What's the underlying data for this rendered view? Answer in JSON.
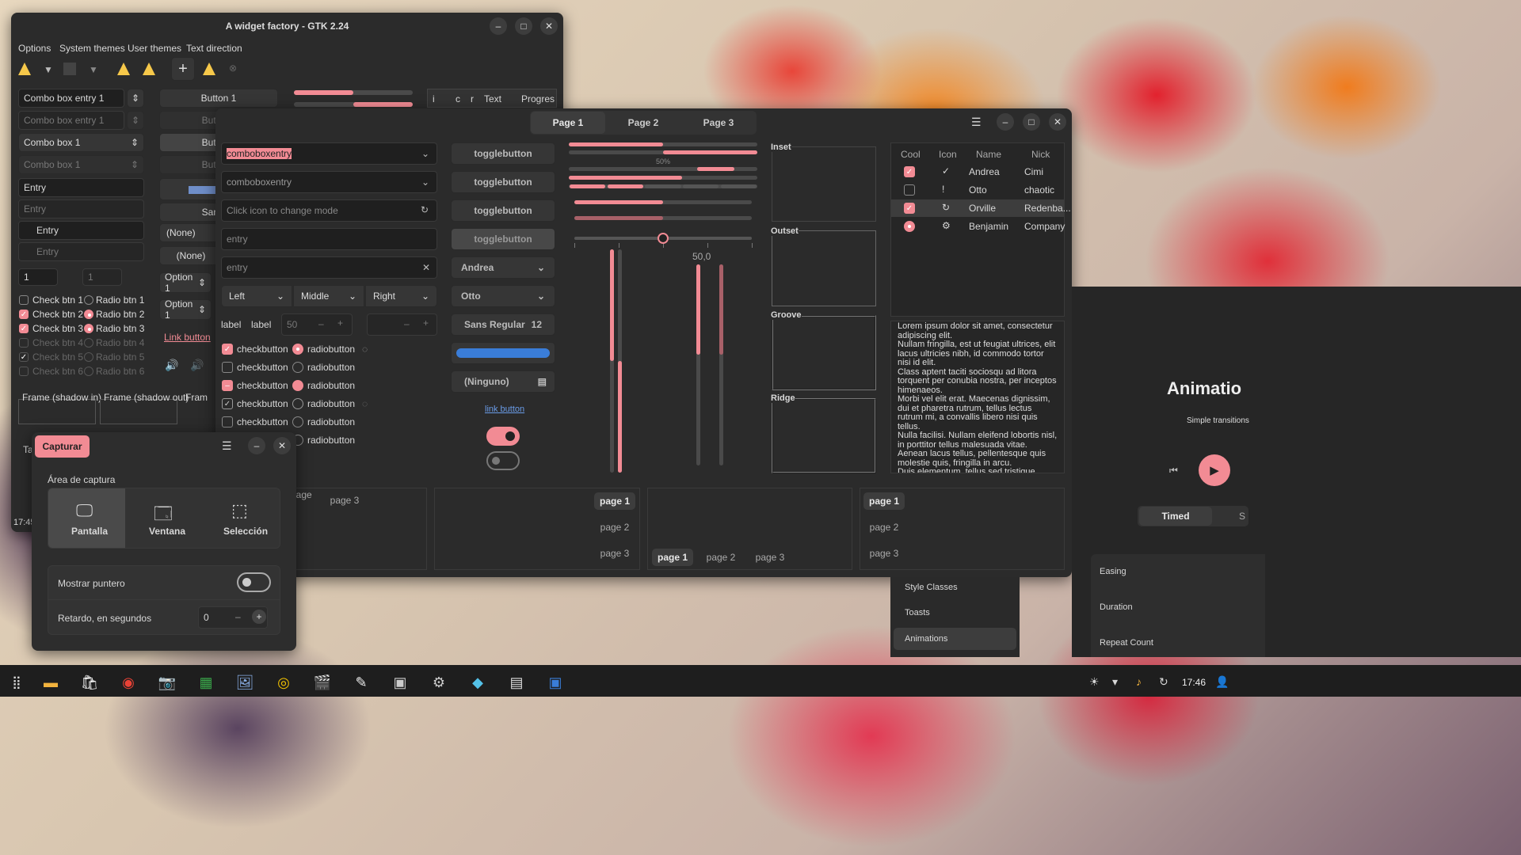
{
  "gtk2": {
    "title": "A widget factory - GTK 2.24",
    "menu": [
      "Options",
      "System themes",
      "User themes",
      "Text direction"
    ],
    "combo_entry_1": "Combo box entry 1",
    "combo_entry_1_dis": "Combo box entry 1",
    "combo_1": "Combo box 1",
    "combo_1_dis": "Combo box 1",
    "entry": "Entry",
    "entry_dis": "Entry",
    "entry_icon": "Entry",
    "entry_icon_dis": "Entry",
    "spin_1": "1",
    "spin_1_dis": "1",
    "checks": [
      "Check btn 1",
      "Check btn 2",
      "Check btn 3",
      "Check btn 4",
      "Check btn 5",
      "Check btn 6"
    ],
    "radios": [
      "Radio btn 1",
      "Radio btn 2",
      "Radio btn 3",
      "Radio btn 4",
      "Radio btn 5",
      "Radio btn 6"
    ],
    "button_1": "Button 1",
    "button_short": [
      "Butt",
      "Butt",
      "Butt"
    ],
    "san": "San",
    "none": "(None)",
    "option_1": "Option 1",
    "link_button": "Link button",
    "frame_in": "Frame (shadow in)",
    "frame_out": "Frame (shadow out)",
    "frame_cut": "Fram",
    "tree_cols": [
      "i",
      "c",
      "r",
      "Text",
      "Progres"
    ],
    "ta": "Ta",
    "time": "17:45"
  },
  "gtk4": {
    "tabs": [
      "Page 1",
      "Page 2",
      "Page 3"
    ],
    "comboboxentry_selected": "comboboxentry",
    "comboboxentry": "comboboxentry",
    "mode_placeholder": "Click icon to change mode",
    "entry_ph": "entry",
    "entry_ph2": "entry",
    "linked": [
      "Left",
      "Middle",
      "Right"
    ],
    "label1": "label",
    "label2": "label",
    "spin": "50",
    "checkbutton": "checkbutton",
    "radiobutton": "radiobutton",
    "togglebutton": "togglebutton",
    "combo_andrea": "Andrea",
    "combo_otto": "Otto",
    "font": "Sans Regular",
    "font_size": "12",
    "file": "(Ninguno)",
    "link": "link button",
    "progress_label": "50%",
    "scale_value": "50,0",
    "frames": [
      "Inset",
      "Outset",
      "Groove",
      "Ridge"
    ],
    "list_headers": [
      "Cool",
      "Icon",
      "Name",
      "Nick"
    ],
    "list_rows": [
      {
        "name": "Andrea",
        "nick": "Cimi"
      },
      {
        "name": "Otto",
        "nick": "chaotic"
      },
      {
        "name": "Orville",
        "nick": "Redenba..."
      },
      {
        "name": "Benjamin",
        "nick": "Company"
      }
    ],
    "lorem": "Lorem ipsum dolor sit amet, consectetur adipiscing elit.\nNullam fringilla, est ut feugiat ultrices, elit lacus ultricies nibh, id commodo tortor nisi id elit.\nClass aptent taciti sociosqu ad litora torquent per conubia nostra, per inceptos himenaeos.\nMorbi vel elit erat. Maecenas dignissim, dui et pharetra rutrum, tellus lectus rutrum mi, a convallis libero nisi quis tellus.\nNulla facilisi. Nullam eleifend lobortis nisl, in porttitor tellus malesuada vitae.\nAenean lacus tellus, pellentesque quis molestie quis, fringilla in arcu.\nDuis elementum, tellus sed tristique semper, metus metus accumsan augue, et porttitor augue orci a libero.",
    "nb1": [
      "page 2",
      "page 3"
    ],
    "nb2": [
      "page 1",
      "page 2",
      "page 3"
    ],
    "nb3": [
      "page 1",
      "page 2",
      "page 3"
    ],
    "nb4": [
      "page 1",
      "page 2",
      "page 3"
    ]
  },
  "capture": {
    "button": "Capturar",
    "area_label": "Área de captura",
    "modes": [
      "Pantalla",
      "Ventana",
      "Selección"
    ],
    "pointer_label": "Mostrar puntero",
    "delay_label": "Retardo, en segundos",
    "delay_value": "0"
  },
  "demo": {
    "title": "Animatio",
    "subtitle": "Simple transitions",
    "timed": "Timed",
    "timed_next": "S",
    "sidebar": [
      "Style Classes",
      "Toasts",
      "Animations"
    ],
    "props": [
      "Easing",
      "Duration",
      "Repeat Count"
    ]
  },
  "taskbar": {
    "clock": "17:46"
  },
  "colors": {
    "accent": "#f28b94",
    "window": "#2d2d2d",
    "panel": "#1e1e1e",
    "blue": "#3a7dd8"
  }
}
